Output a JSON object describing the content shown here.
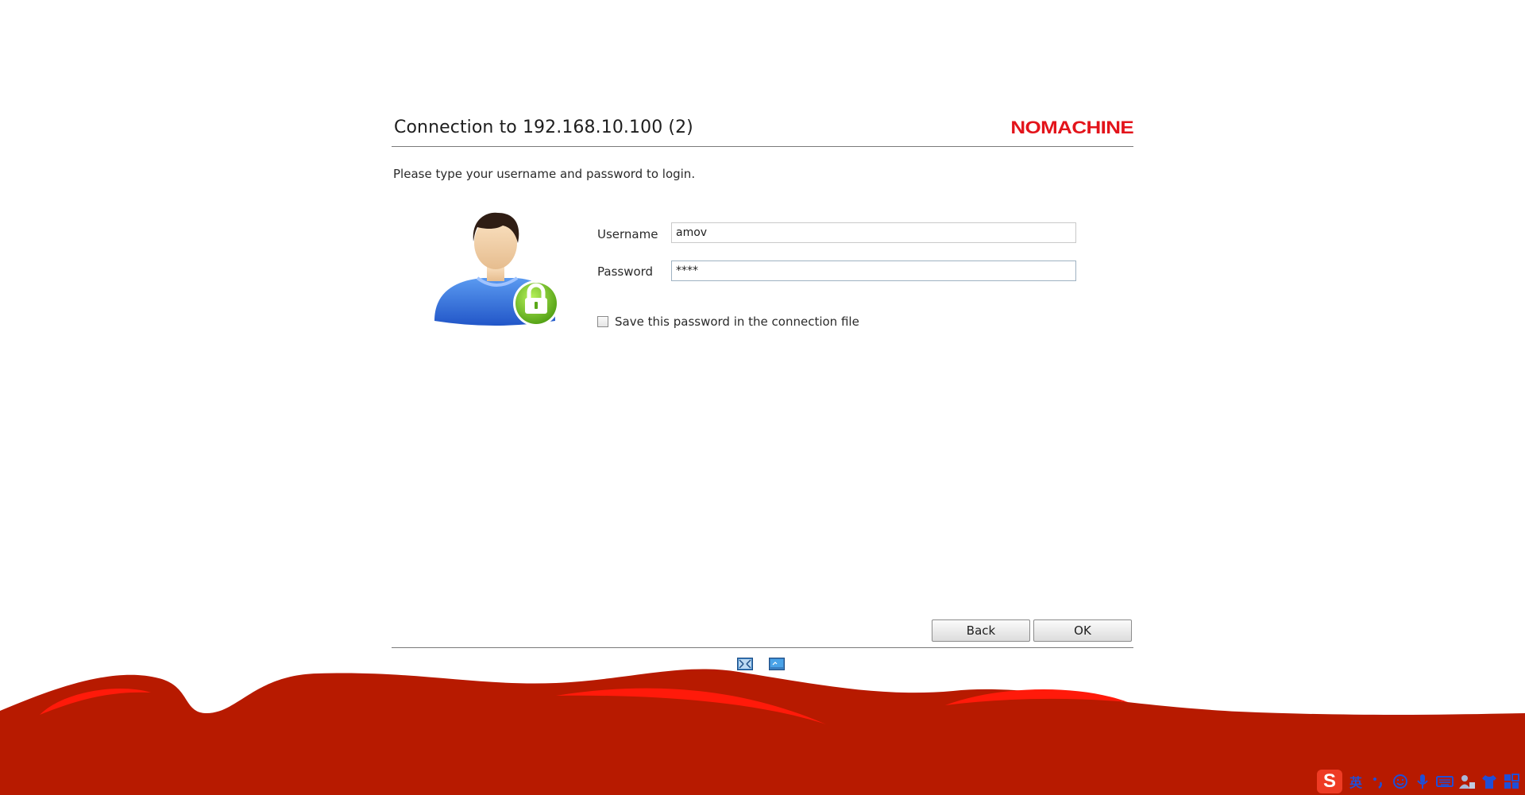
{
  "dialog": {
    "title": "Connection to 192.168.10.100 (2)",
    "logo": "NOMACHINE",
    "instruction": "Please type your username and password to login."
  },
  "form": {
    "username_label": "Username",
    "username_value": "amov",
    "password_label": "Password",
    "password_value": "****",
    "save_password_label": "Save this password in the connection file",
    "save_password_checked": false
  },
  "buttons": {
    "back": "Back",
    "ok": "OK"
  },
  "bottom_icons": [
    "fullscreen-icon",
    "display-icon"
  ],
  "tray": {
    "ime_logo": "S",
    "ime_language": "英",
    "icons": [
      "punctuation-icon",
      "emoji-icon",
      "microphone-icon",
      "keyboard-icon",
      "user-tools-icon",
      "skin-icon",
      "grid-menu-icon"
    ]
  },
  "colors": {
    "brand_red": "#e3141b",
    "wave_red": "#b71a00",
    "wave_highlight": "#ff1a0a"
  }
}
